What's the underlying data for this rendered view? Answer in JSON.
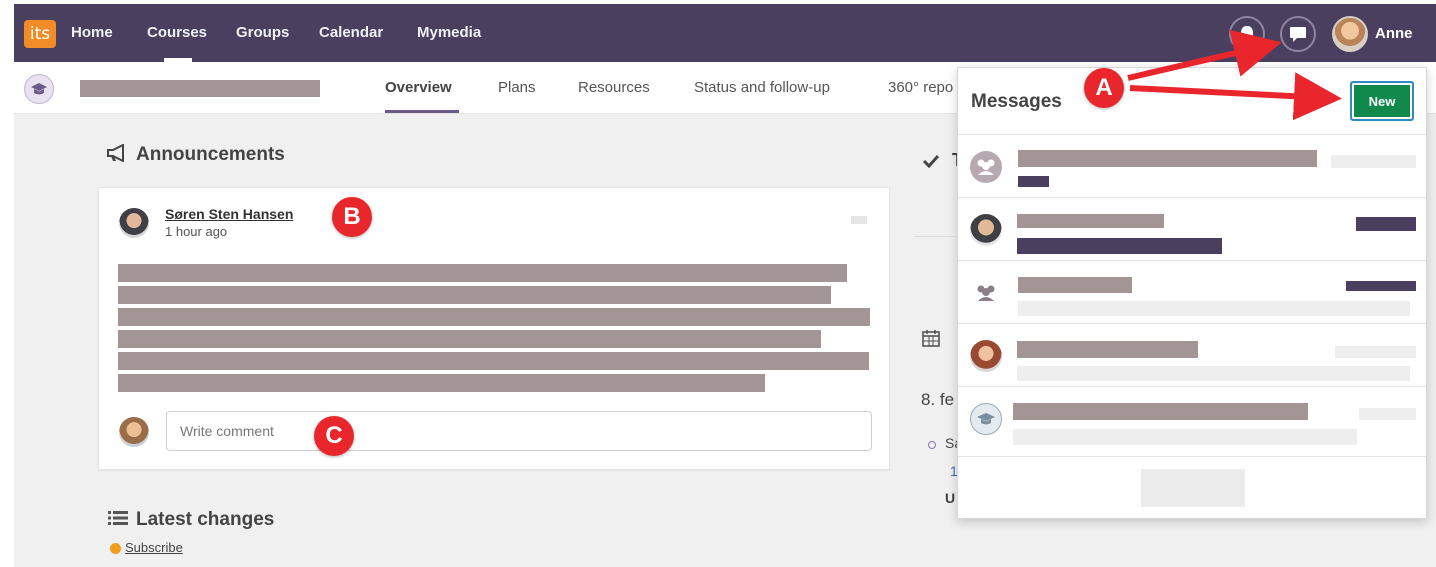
{
  "nav": {
    "logo_text": "its",
    "items": [
      "Home",
      "Courses",
      "Groups",
      "Calendar",
      "Mymedia"
    ],
    "user_name": "Anne"
  },
  "course": {
    "tabs": [
      "Overview",
      "Plans",
      "Resources",
      "Status and follow-up",
      "360° repo"
    ]
  },
  "announcements": {
    "heading": "Announcements",
    "author": "Søren Sten Hansen",
    "time": "1 hour ago",
    "comment_placeholder": "Write comment"
  },
  "latest_changes": {
    "heading": "Latest changes",
    "subscribe_label": "Subscribe"
  },
  "right_column": {
    "date_partial": "8. fe",
    "item_partial": "Sa",
    "link_partial": "1",
    "bold_partial": "U",
    "first_partial": "T"
  },
  "messages": {
    "title": "Messages",
    "new_label": "New"
  },
  "markers": [
    "A",
    "B",
    "C"
  ],
  "colors": {
    "nav_bg": "#4a3f5f",
    "logo": "#f28c28",
    "new_button": "#11884c",
    "marker": "#e8262b",
    "redacted": "#a39596",
    "dark_redacted": "#4a3f5f"
  },
  "icons": {
    "announcements": "megaphone-icon",
    "latest_changes": "list-icon",
    "subscribe": "rss-icon",
    "calendar": "calendar-icon",
    "tasks": "checkmark-icon",
    "notifications": "bell-icon",
    "messages": "speech-bubble-icon"
  }
}
